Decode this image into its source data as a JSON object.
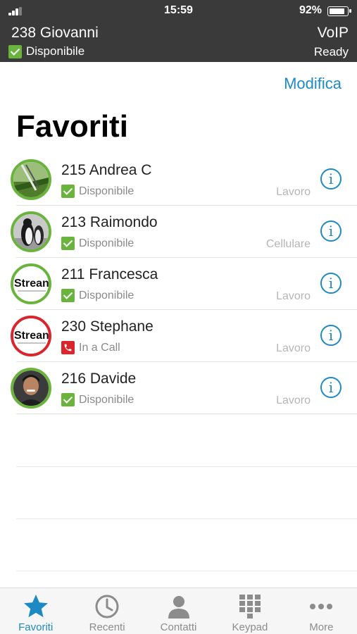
{
  "status_bar": {
    "time": "15:59",
    "battery_percent": "92%",
    "battery_level": 0.92,
    "signal_bars": 3
  },
  "header": {
    "user_name": "238 Giovanni",
    "user_status": "Disponibile",
    "voip_title": "VoIP",
    "voip_status": "Ready"
  },
  "edit_label": "Modifica",
  "page_title": "Favoriti",
  "favorites": [
    {
      "name": "215 Andrea C",
      "status": "Disponibile",
      "status_kind": "available",
      "number_type": "Lavoro",
      "avatar": "golf-photo"
    },
    {
      "name": "213 Raimondo",
      "status": "Disponibile",
      "status_kind": "available",
      "number_type": "Cellulare",
      "avatar": "penguin-photo"
    },
    {
      "name": "211 Francesca",
      "status": "Disponibile",
      "status_kind": "available",
      "number_type": "Lavoro",
      "avatar": "stream-logo",
      "avatar_text": "Strean"
    },
    {
      "name": "230 Stephane",
      "status": "In a Call",
      "status_kind": "busy",
      "number_type": "Lavoro",
      "avatar": "stream-logo",
      "avatar_text": "Strean"
    },
    {
      "name": "216 Davide",
      "status": "Disponibile",
      "status_kind": "available",
      "number_type": "Lavoro",
      "avatar": "person-photo"
    }
  ],
  "tabs": [
    {
      "label": "Favoriti",
      "icon": "star-icon",
      "active": true
    },
    {
      "label": "Recenti",
      "icon": "clock-icon",
      "active": false
    },
    {
      "label": "Contatti",
      "icon": "person-icon",
      "active": false
    },
    {
      "label": "Keypad",
      "icon": "keypad-icon",
      "active": false
    },
    {
      "label": "More",
      "icon": "more-icon",
      "active": false
    }
  ],
  "colors": {
    "header_bg": "#3a3a3a",
    "accent": "#1e8ac4",
    "available": "#6ab43e",
    "busy": "#d9262c"
  }
}
